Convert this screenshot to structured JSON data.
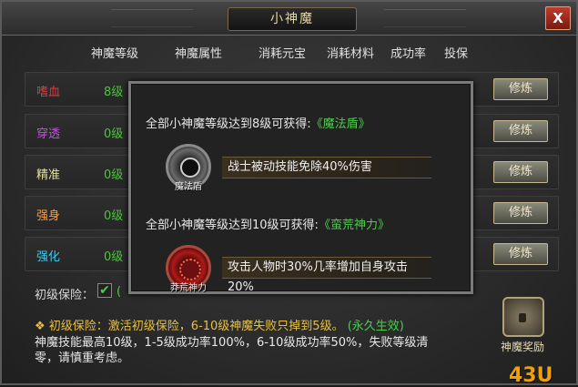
{
  "window": {
    "title": "小神魔"
  },
  "headers": [
    "神魔等级",
    "神魔属性",
    "消耗元宝",
    "消耗材料",
    "成功率",
    "投保"
  ],
  "rows": [
    {
      "name": "嗜血",
      "color": "#e03a3a",
      "level": "8级",
      "button": "修炼"
    },
    {
      "name": "穿透",
      "color": "#c050e0",
      "level": "0级",
      "button": "修炼"
    },
    {
      "name": "精准",
      "color": "#e0e0a0",
      "level": "0级",
      "button": "修炼"
    },
    {
      "name": "强身",
      "color": "#ff9a3c",
      "level": "0级",
      "button": "修炼"
    },
    {
      "name": "强化",
      "color": "#40c8e8",
      "level": "0级",
      "button": "修炼"
    }
  ],
  "insurance": {
    "label": "初级保险：",
    "checked_mark": "✔",
    "after": "("
  },
  "note": {
    "prefix": "❖ 初级保险：",
    "desc": "激活初级保险，6-10级神魔失败只掉到5级。",
    "suffix": "(永久生效)"
  },
  "info": "神魔技能最高10级，1-5级成功率100%，6-10级成功率50%，失败等级清零，请慎重考虑。",
  "reward": {
    "label": "神魔奖励"
  },
  "watermark": "43U",
  "tooltip": {
    "line1_prefix": "全部小神魔等级达到8级可获得:",
    "line1_item": "《魔法盾》",
    "skill1": {
      "caption": "魔法盾",
      "effect": "战士被动技能免除40%伤害"
    },
    "line2_prefix": "全部小神魔等级达到10级可获得:",
    "line2_item": "《蛮荒神力》",
    "skill2": {
      "caption": "莽荒神力",
      "effect": "攻击人物时30%几率增加自身攻击20%"
    }
  }
}
